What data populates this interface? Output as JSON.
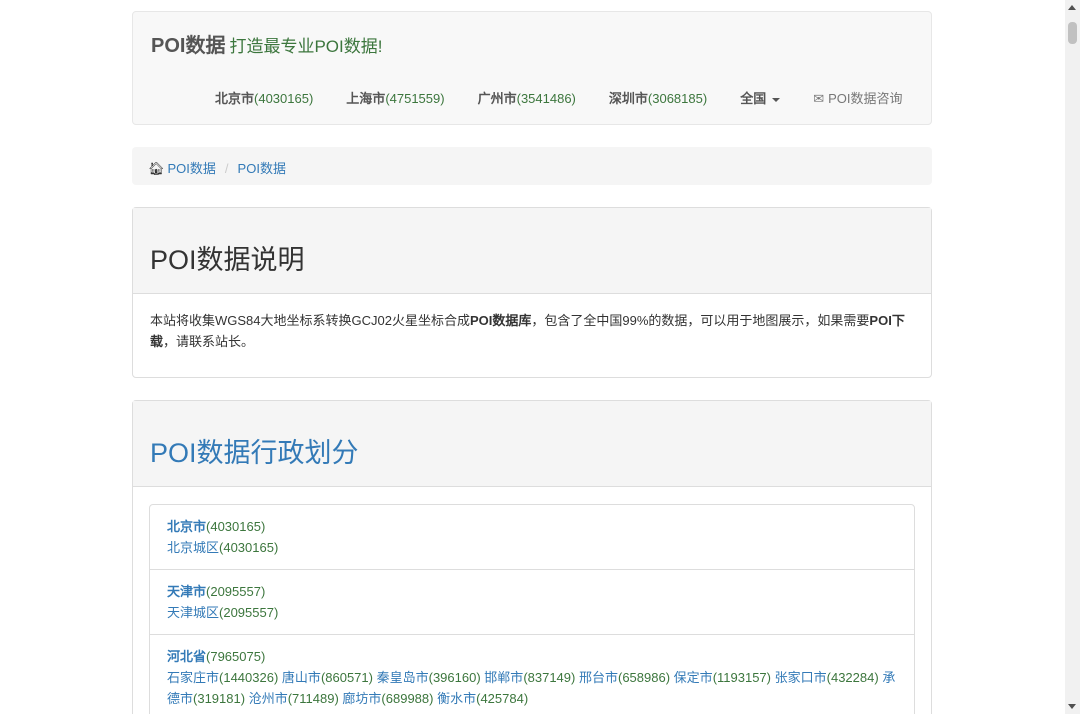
{
  "navbar": {
    "brand": "POI数据",
    "tagline": "打造最专业POI数据!",
    "items": [
      {
        "name": "北京市",
        "count": "(4030165)"
      },
      {
        "name": "上海市",
        "count": "(4751559)"
      },
      {
        "name": "广州市",
        "count": "(3541486)"
      },
      {
        "name": "深圳市",
        "count": "(3068185)"
      }
    ],
    "dropdown_label": "全国",
    "consult_label": "POI数据咨询"
  },
  "breadcrumb": {
    "home": "POI数据",
    "separator": "/",
    "current": "POI数据"
  },
  "intro_panel": {
    "title": "POI数据说明",
    "text_1": "本站将收集WGS84大地坐标系转换GCJ02火星坐标合成",
    "bold_1": "POI数据库",
    "text_2": "，包含了全中国99%的数据，可以用于地图展示，如果需要",
    "bold_2": "POI下载",
    "text_3": "，请联系站长。"
  },
  "division_panel": {
    "title": "POI数据行政划分",
    "provinces": [
      {
        "name": "北京市",
        "count": "(4030165)",
        "cities": [
          {
            "name": "北京城区",
            "count": "(4030165)"
          }
        ]
      },
      {
        "name": "天津市",
        "count": "(2095557)",
        "cities": [
          {
            "name": "天津城区",
            "count": "(2095557)"
          }
        ]
      },
      {
        "name": "河北省",
        "count": "(7965075)",
        "cities": [
          {
            "name": "石家庄市",
            "count": "(1440326)"
          },
          {
            "name": "唐山市",
            "count": "(860571)"
          },
          {
            "name": "秦皇岛市",
            "count": "(396160)"
          },
          {
            "name": "邯郸市",
            "count": "(837149)"
          },
          {
            "name": "邢台市",
            "count": "(658986)"
          },
          {
            "name": "保定市",
            "count": "(1193157)"
          },
          {
            "name": "张家口市",
            "count": "(432284)"
          },
          {
            "name": "承德市",
            "count": "(319181)"
          },
          {
            "name": "沧州市",
            "count": "(711489)"
          },
          {
            "name": "廊坊市",
            "count": "(689988)"
          },
          {
            "name": "衡水市",
            "count": "(425784)"
          }
        ]
      }
    ]
  },
  "colors": {
    "link": "#337ab7",
    "count_green": "#3c763d",
    "panel_bg": "#f5f5f5"
  }
}
